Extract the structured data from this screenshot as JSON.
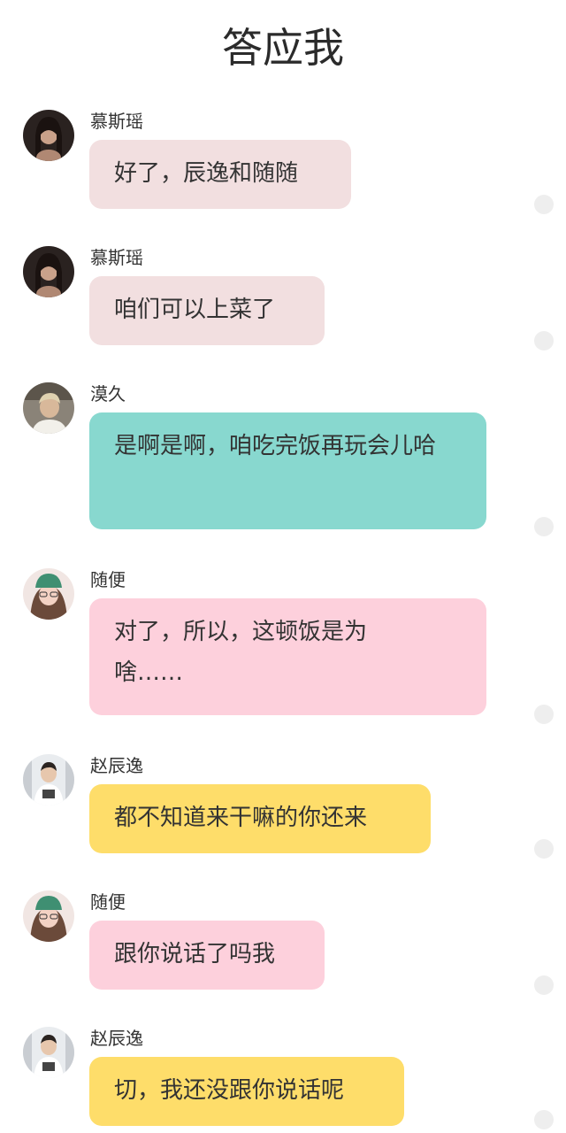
{
  "header": {
    "title": "答应我"
  },
  "messages": [
    {
      "sender": "慕斯瑶",
      "text": "好了，辰逸和随随",
      "bubble_color": "#f2dfe0",
      "avatar": "girl-dark-hair-avatar"
    },
    {
      "sender": "慕斯瑶",
      "text": "咱们可以上菜了",
      "bubble_color": "#f2dfe0",
      "avatar": "girl-dark-hair-avatar"
    },
    {
      "sender": "漠久",
      "text": "是啊是啊，咱吃完饭再玩会儿哈",
      "bubble_color": "#88d8cf",
      "avatar": "boy-photo-avatar"
    },
    {
      "sender": "随便",
      "text": "对了，所以，这顿饭是为啥……",
      "bubble_color": "#fdd0dc",
      "avatar": "girl-green-cap-avatar"
    },
    {
      "sender": "赵辰逸",
      "text": "都不知道来干嘛的你还来",
      "bubble_color": "#fedd6a",
      "avatar": "boy-white-tee-avatar"
    },
    {
      "sender": "随便",
      "text": "跟你说话了吗我",
      "bubble_color": "#fdd0dc",
      "avatar": "girl-green-cap-avatar"
    },
    {
      "sender": "赵辰逸",
      "text": "切，我还没跟你说话呢",
      "bubble_color": "#fedd6a",
      "avatar": "boy-white-tee-avatar"
    }
  ]
}
